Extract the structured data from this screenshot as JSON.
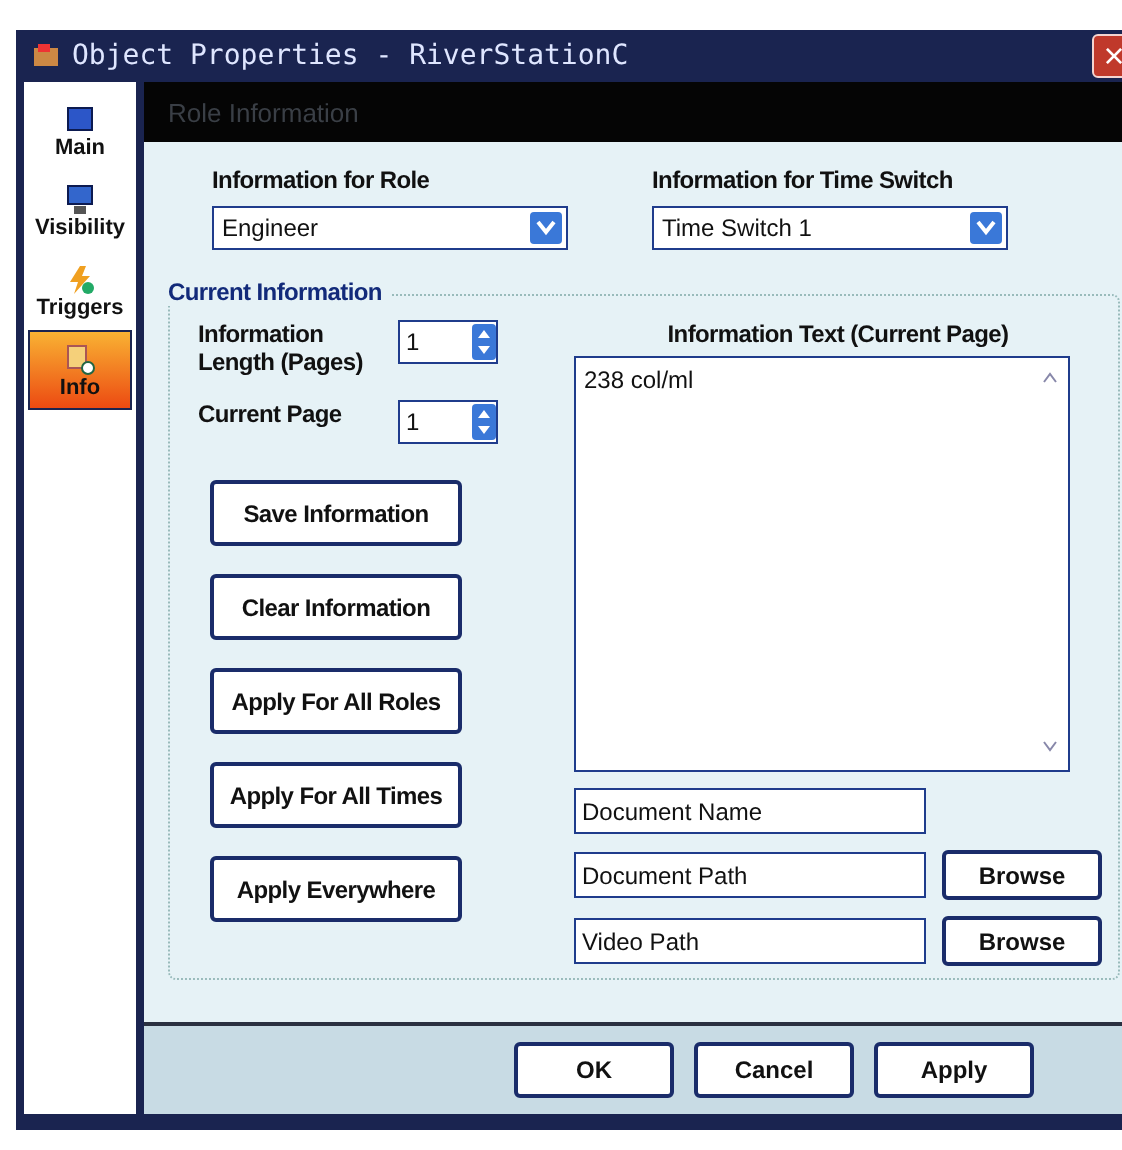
{
  "window": {
    "title": "Object Properties - RiverStationC",
    "close": "×"
  },
  "sidebar": {
    "items": [
      {
        "label": "Main",
        "kind": "monitor",
        "selected": false
      },
      {
        "label": "Visibility",
        "kind": "screen",
        "selected": false
      },
      {
        "label": "Triggers",
        "kind": "bolt",
        "selected": false
      },
      {
        "label": "Info",
        "kind": "info",
        "selected": true
      }
    ]
  },
  "header": {
    "title": "Role Information"
  },
  "role": {
    "label": "Information for Role",
    "value": "Engineer"
  },
  "time_switch": {
    "label": "Information for Time Switch",
    "value": "Time Switch 1"
  },
  "group": {
    "title": "Current Information"
  },
  "length": {
    "label": "Information Length (Pages)",
    "value": "1"
  },
  "page": {
    "label": "Current Page",
    "value": "1"
  },
  "info_text": {
    "label": "Information Text (Current Page)",
    "value": "238 col/ml"
  },
  "actions": [
    "Save Information",
    "Clear Information",
    "Apply For All Roles",
    "Apply For All Times",
    "Apply Everywhere"
  ],
  "fields": [
    {
      "value": "Document Name"
    },
    {
      "value": "Document Path",
      "browse": "Browse"
    },
    {
      "value": "Video Path",
      "browse": "Browse"
    }
  ],
  "buttons": [
    "OK",
    "Cancel",
    "Apply"
  ]
}
